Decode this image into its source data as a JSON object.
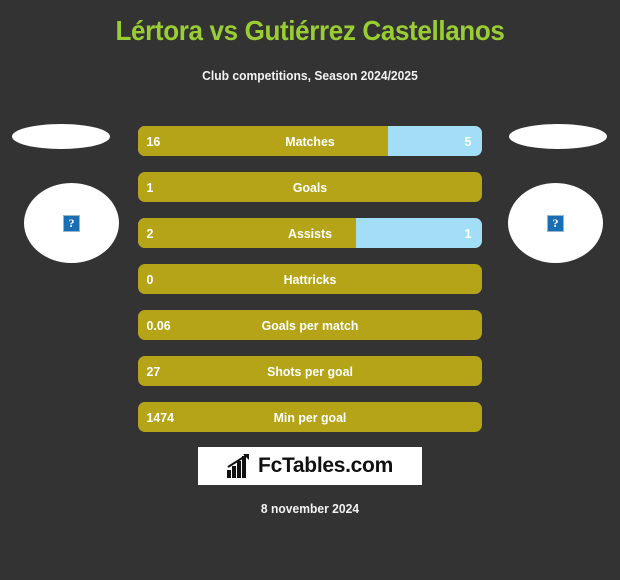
{
  "header": {
    "title": "Lértora vs Gutiérrez Castellanos",
    "subtitle": "Club competitions, Season 2024/2025"
  },
  "colors": {
    "background": "#333333",
    "title_green": "#9ACD32",
    "bar_gold": "#B5A417",
    "bar_blue": "#A2DFF7",
    "text_white": "#FFFFFF",
    "logo_background": "#FFFFFF"
  },
  "players": {
    "home": {
      "flag_icon": "flag-placeholder-icon",
      "photo_icon": "broken-image-icon",
      "photo_glyph": "?"
    },
    "away": {
      "flag_icon": "flag-placeholder-icon",
      "photo_icon": "broken-image-icon",
      "photo_glyph": "?"
    }
  },
  "stats": [
    {
      "label": "Matches",
      "home": "16",
      "away": "5",
      "home_pct": 72.7,
      "has_away": true
    },
    {
      "label": "Goals",
      "home": "1",
      "away": "",
      "home_pct": 100,
      "has_away": false
    },
    {
      "label": "Assists",
      "home": "2",
      "away": "1",
      "home_pct": 63.4,
      "has_away": true
    },
    {
      "label": "Hattricks",
      "home": "0",
      "away": "",
      "home_pct": 100,
      "has_away": false
    },
    {
      "label": "Goals per match",
      "home": "0.06",
      "away": "",
      "home_pct": 100,
      "has_away": false
    },
    {
      "label": "Shots per goal",
      "home": "27",
      "away": "",
      "home_pct": 100,
      "has_away": false
    },
    {
      "label": "Min per goal",
      "home": "1474",
      "away": "",
      "home_pct": 100,
      "has_away": false
    }
  ],
  "footer": {
    "logo_icon": "bar-chart-icon",
    "logo_text": "FcTables.com",
    "date": "8 november 2024"
  },
  "chart_data": {
    "type": "bar",
    "title": "Lértora vs Gutiérrez Castellanos",
    "subtitle": "Club competitions, Season 2024/2025",
    "categories": [
      "Matches",
      "Goals",
      "Assists",
      "Hattricks",
      "Goals per match",
      "Shots per goal",
      "Min per goal"
    ],
    "series": [
      {
        "name": "Lértora",
        "color": "#B5A417",
        "values": [
          16,
          1,
          2,
          0,
          0.06,
          27,
          1474
        ]
      },
      {
        "name": "Gutiérrez Castellanos",
        "color": "#A2DFF7",
        "values": [
          5,
          null,
          1,
          null,
          null,
          null,
          null
        ]
      }
    ],
    "orientation": "horizontal",
    "grid": false,
    "legend": "none"
  }
}
